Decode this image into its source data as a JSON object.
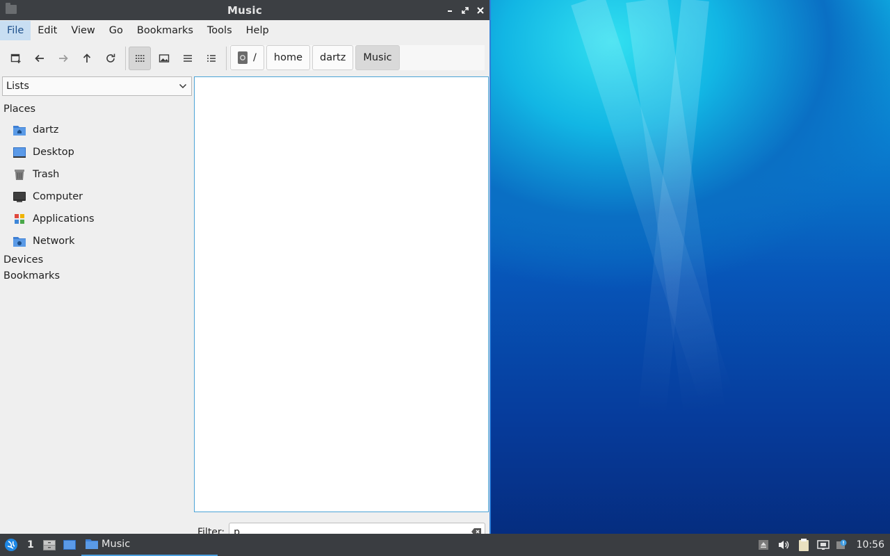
{
  "window": {
    "title": "Music",
    "icon": "folder-icon",
    "controls": [
      "minimize-icon",
      "maximize-icon",
      "close-icon"
    ]
  },
  "menubar": {
    "items": [
      "File",
      "Edit",
      "View",
      "Go",
      "Bookmarks",
      "Tools",
      "Help"
    ],
    "active": "File"
  },
  "toolbar": {
    "buttons": [
      "new-tab-icon",
      "back-arrow-icon",
      "forward-arrow-icon",
      "up-arrow-icon",
      "reload-icon"
    ],
    "view_modes": [
      "icon-view-icon",
      "thumbnail-view-icon",
      "compact-view-icon",
      "detailed-list-view-icon"
    ],
    "selected_view": "icon-view-icon"
  },
  "pathbar": {
    "crumbs": [
      "/",
      "home",
      "dartz",
      "Music"
    ],
    "current": "Music"
  },
  "sidebar": {
    "mode_select": "Lists",
    "sections": {
      "places": "Places",
      "devices": "Devices",
      "bookmarks": "Bookmarks"
    },
    "places": [
      {
        "label": "dartz",
        "icon": "home-folder-icon"
      },
      {
        "label": "Desktop",
        "icon": "desktop-icon"
      },
      {
        "label": "Trash",
        "icon": "trash-icon"
      },
      {
        "label": "Computer",
        "icon": "computer-icon"
      },
      {
        "label": "Applications",
        "icon": "applications-icon"
      },
      {
        "label": "Network",
        "icon": "network-icon"
      }
    ]
  },
  "filter": {
    "label": "Filter:",
    "value": "p"
  },
  "taskbar": {
    "workspace": "1",
    "task_label": "Music",
    "clock": "10:56"
  },
  "colors": {
    "accent": "#2f7fd8",
    "titlebar": "#3c3f43",
    "taskbar": "#3a3d41",
    "menu_active_bg": "#c8def2"
  }
}
